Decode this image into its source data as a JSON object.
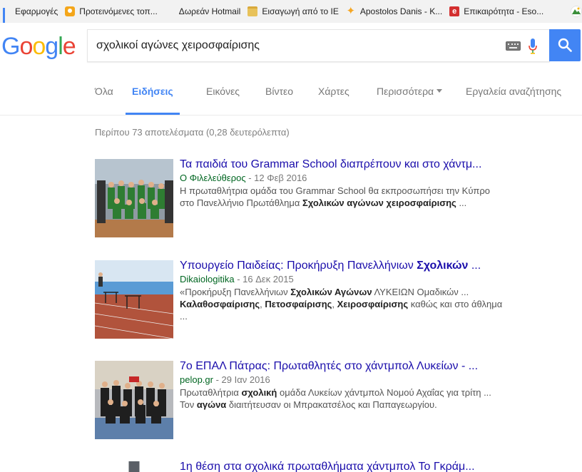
{
  "bookmarks": [
    {
      "icon": "apps-grid-icon",
      "label": "Εφαρμογές"
    },
    {
      "icon": "lightbulb-icon",
      "label": "Προτεινόμενες τοπ..."
    },
    {
      "icon": "windows-logo-icon",
      "label": "Δωρεάν Hotmail"
    },
    {
      "icon": "folder-icon",
      "label": "Εισαγωγή από το IE"
    },
    {
      "icon": "star-icon",
      "label": "Apostolos Danis - K..."
    },
    {
      "icon": "e-square-icon",
      "label": "Επικαιρότητα - Eso..."
    }
  ],
  "search": {
    "query": "σχολικοί αγώνες χειροσφαίρισης"
  },
  "tabs": [
    {
      "label": "Όλα",
      "active": false
    },
    {
      "label": "Ειδήσεις",
      "active": true
    },
    {
      "label": "Εικόνες",
      "active": false
    },
    {
      "label": "Βίντεο",
      "active": false
    },
    {
      "label": "Χάρτες",
      "active": false
    },
    {
      "label": "Περισσότερα",
      "active": false
    },
    {
      "label": "Εργαλεία αναζήτησης",
      "active": false
    }
  ],
  "stats": "Περίπου 73 αποτελέσματα (0,28 δευτερόλεπτα)",
  "results": [
    {
      "title": "Τα παιδιά του Grammar School διαπρέπουν και στο χάντμ...",
      "source": "Ο Φιλελεύθερος",
      "date": " - 12 Φεβ 2016",
      "snippet_parts": [
        {
          "text": "Η πρωταθλήτρια ομάδα του Grammar School θα εκπροσωπήσει την Κύπρο στο Πανελλήνιο Πρωτάθλημα ",
          "bold": false
        },
        {
          "text": "Σχολικών αγώνων χειροσφαίρισης",
          "bold": true
        },
        {
          "text": " ...",
          "bold": false
        }
      ]
    },
    {
      "title_parts": [
        {
          "text": "Υπουργείο Παιδείας: Προκήρυξη Πανελλήνιων ",
          "bold": false
        },
        {
          "text": "Σχολικών",
          "bold": true
        },
        {
          "text": " ...",
          "bold": false
        }
      ],
      "source": "Dikaiologitika",
      "date": " - 16 Δεκ 2015",
      "snippet_parts": [
        {
          "text": "«Προκήρυξη Πανελλήνιων ",
          "bold": false
        },
        {
          "text": "Σχολικών Αγώνων",
          "bold": true
        },
        {
          "text": " ΛΥΚΕΙΩΝ Ομαδικών ... ",
          "bold": false
        },
        {
          "text": "Καλαθοσφαίρισης",
          "bold": true
        },
        {
          "text": ", ",
          "bold": false
        },
        {
          "text": "Πετοσφαίρισης",
          "bold": true
        },
        {
          "text": ", ",
          "bold": false
        },
        {
          "text": "Χειροσφαίρισης",
          "bold": true
        },
        {
          "text": " καθώς και στο άθλημα ...",
          "bold": false
        }
      ]
    },
    {
      "title": "7ο ΕΠΑΛ Πάτρας: Πρωταθλητές στο χάντμπολ Λυκείων - ...",
      "source": "pelop.gr",
      "date": " - 29 Ιαν 2016",
      "snippet_parts": [
        {
          "text": "Πρωταθλήτρια ",
          "bold": false
        },
        {
          "text": "σχολική",
          "bold": true
        },
        {
          "text": " ομάδα Λυκείων χάντμπολ Νομού Αχαΐας για τρίτη ... Τον ",
          "bold": false
        },
        {
          "text": "αγώνα",
          "bold": true
        },
        {
          "text": " διαιτήτευσαν οι Μπρακατσέλος και Παπαγεωργίου.",
          "bold": false
        }
      ]
    },
    {
      "title": "1η θέση στα σχολικά πρωταθλήματα χάντμπολ Το Γκράμ..."
    }
  ]
}
